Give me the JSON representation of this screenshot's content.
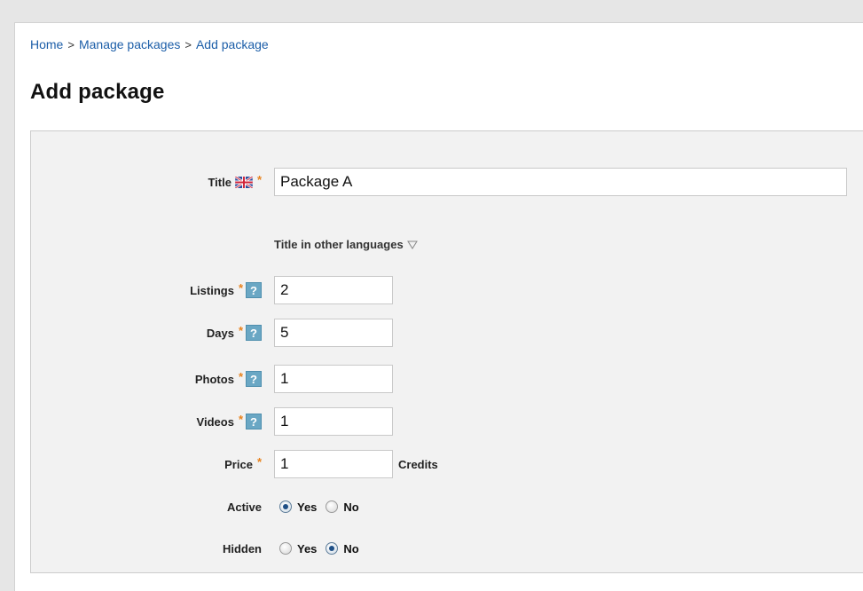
{
  "breadcrumb": {
    "home": "Home",
    "manage": "Manage packages",
    "current": "Add package",
    "separator": ">"
  },
  "page_title": "Add package",
  "form": {
    "title": {
      "label": "Title",
      "value": "Package A",
      "required_mark": "*",
      "flag_icon": "uk-flag-icon"
    },
    "other_languages": {
      "label": "Title in other languages"
    },
    "listings": {
      "label": "Listings",
      "value": "2",
      "required_mark": "*",
      "help": "?"
    },
    "days": {
      "label": "Days",
      "value": "5",
      "required_mark": "*",
      "help": "?"
    },
    "photos": {
      "label": "Photos",
      "value": "1",
      "required_mark": "*",
      "help": "?"
    },
    "videos": {
      "label": "Videos",
      "value": "1",
      "required_mark": "*",
      "help": "?"
    },
    "price": {
      "label": "Price",
      "value": "1",
      "required_mark": "*",
      "suffix": "Credits"
    },
    "active": {
      "label": "Active",
      "yes": "Yes",
      "no": "No",
      "selected": "Yes"
    },
    "hidden": {
      "label": "Hidden",
      "yes": "Yes",
      "no": "No",
      "selected": "No"
    }
  },
  "colors": {
    "link": "#1c5ea8",
    "required": "#e8821c",
    "help_bg": "#6aa7c4",
    "panel_bg": "#f2f2f2"
  }
}
